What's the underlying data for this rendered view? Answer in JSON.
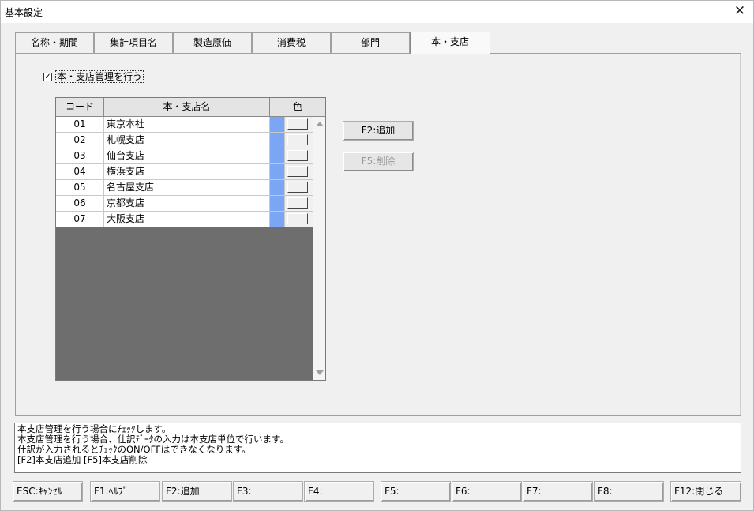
{
  "window": {
    "title": "基本設定",
    "close_glyph": "✕"
  },
  "tabs": [
    {
      "label": "名称・期間",
      "active": false
    },
    {
      "label": "集計項目名",
      "active": false
    },
    {
      "label": "製造原価",
      "active": false
    },
    {
      "label": "消費税",
      "active": false
    },
    {
      "label": "部門",
      "active": false
    },
    {
      "label": "本・支店",
      "active": true
    }
  ],
  "branch_mgmt": {
    "checked": true,
    "check_glyph": "✓",
    "label": "本・支店管理を行う"
  },
  "grid": {
    "headers": {
      "code": "コード",
      "name": "本・支店名",
      "color": "色"
    },
    "rows": [
      {
        "code": "01",
        "name": "東京本社",
        "color": "#7ba5f5"
      },
      {
        "code": "02",
        "name": "札幌支店",
        "color": "#7ba5f5"
      },
      {
        "code": "03",
        "name": "仙台支店",
        "color": "#7ba5f5"
      },
      {
        "code": "04",
        "name": "横浜支店",
        "color": "#7ba5f5"
      },
      {
        "code": "05",
        "name": "名古屋支店",
        "color": "#7ba5f5"
      },
      {
        "code": "06",
        "name": "京都支店",
        "color": "#7ba5f5"
      },
      {
        "code": "07",
        "name": "大阪支店",
        "color": "#7ba5f5"
      }
    ]
  },
  "buttons": {
    "add": "F2:追加",
    "delete": "F5:削除"
  },
  "message": {
    "lines": [
      "本支店管理を行う場合にﾁｪｯｸします。",
      "本支店管理を行う場合、仕訳ﾃﾞｰﾀの入力は本支店単位で行います。",
      "仕訳が入力されるとﾁｪｯｸのON/OFFはできなくなります。",
      "[F2]本支店追加 [F5]本支店削除"
    ]
  },
  "fkeys": [
    "ESC:ｷｬﾝｾﾙ",
    "F1:ﾍﾙﾌﾟ",
    "F2:追加",
    "F3:",
    "F4:",
    "F5:",
    "F6:",
    "F7:",
    "F8:",
    "F12:閉じる"
  ]
}
